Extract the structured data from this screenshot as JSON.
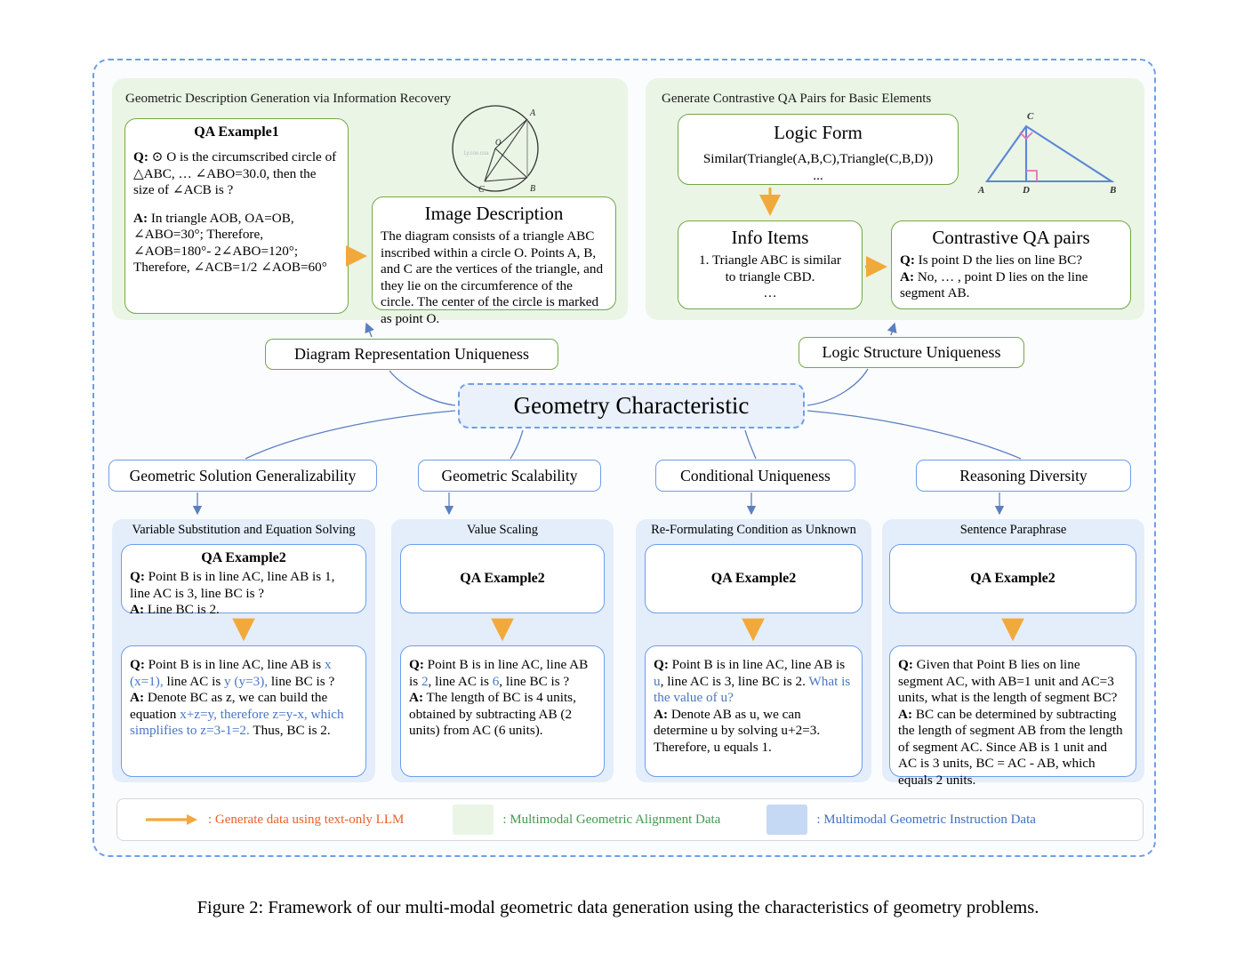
{
  "figure": {
    "caption": "Figure 2: Framework of our multi-modal geometric data generation using the characteristics of geometry problems."
  },
  "alignment_panels": [
    {
      "title": "Geometric Description Generation via Information Recovery",
      "qa_example": {
        "heading": "QA Example1",
        "question": "Q: ⊙ O is the circumscribed circle of △ABC, … ∠ABO=30.0, then the size of ∠ACB is ?",
        "question_prefix": "Q:",
        "question_body": " ⊙ O is the circumscribed circle of △ABC, … ∠ABO=30.0, then the size of ∠ACB is ?",
        "answer_prefix": "A:",
        "answer_body": " In triangle AOB, OA=OB, ∠ABO=30°; Therefore, ∠AOB=180°- 2∠ABO=120°; Therefore, ∠ACB=1/2 ∠AOB=60°"
      },
      "image_description": {
        "heading": "Image Description",
        "text": "The diagram consists of  a triangle ABC inscribed within a circle O. Points A, B, and C are the vertices of the triangle, and they lie on the circumference of the circle. The center of the circle is marked as point O."
      },
      "diagram_labels": [
        "A",
        "B",
        "C",
        "O"
      ]
    },
    {
      "title": "Generate Contrastive QA Pairs for Basic Elements",
      "logic_form": {
        "heading": "Logic Form",
        "text": "Similar(Triangle(A,B,C),Triangle(C,B,D))",
        "ellipsis": "..."
      },
      "info_items": {
        "heading": "Info Items",
        "line1": "1. Triangle ABC is similar",
        "line2": "to triangle CBD.",
        "ellipsis": "…"
      },
      "contrastive_qa": {
        "heading": "Contrastive  QA pairs",
        "question_prefix": "Q:",
        "question_body": " Is point D the lies on line BC?",
        "answer_prefix": "A:",
        "answer_body": " No, … , point D lies on the line segment AB."
      },
      "diagram_labels": [
        "A",
        "B",
        "C",
        "D"
      ]
    }
  ],
  "characteristic_nodes": {
    "center": "Geometry Characteristic",
    "upper": [
      {
        "label": "Diagram Representation Uniqueness"
      },
      {
        "label": "Logic Structure Uniqueness"
      }
    ],
    "lower": [
      {
        "label": "Geometric Solution Generalizability"
      },
      {
        "label": "Geometric Scalability"
      },
      {
        "label": "Conditional Uniqueness"
      },
      {
        "label": "Reasoning Diversity"
      }
    ]
  },
  "instruction_columns": [
    {
      "title": "Variable Substitution and Equation Solving",
      "source": {
        "heading": "QA Example2",
        "question_prefix": "Q:",
        "question_body": " Point B is in line AC, line AB is 1, line AC is 3, line BC is ?",
        "answer_prefix": "A:",
        "answer_body": " Line BC is 2."
      },
      "result": {
        "q_prefix": "Q:",
        "q_part1": " Point B is in line AC, line AB is ",
        "q_var1": "x (x=1),",
        "q_part2": " line AC is ",
        "q_var2": "y (y=3),",
        "q_part3": " line BC is ?",
        "a_prefix": "A:",
        "a_part1": " Denote BC as z, we can build the equation ",
        "a_highlight": "x+z=y, therefore z=y-x, which simplifies to z=3-1=2.",
        "a_part2": " Thus, BC is 2."
      }
    },
    {
      "title": "Value Scaling",
      "source": {
        "heading": "QA Example2"
      },
      "result": {
        "q_prefix": "Q:",
        "q_part1": " Point B is in line AC, line AB is ",
        "q_var1": "2",
        "q_part2": ", line AC is ",
        "q_var2": "6",
        "q_part3": ", line BC is ?",
        "a_prefix": "A:",
        "a_part1": " The length of BC is 4 units, obtained by subtracting AB (2 units) from AC (6 units)."
      }
    },
    {
      "title": "Re-Formulating Condition as Unknown",
      "source": {
        "heading": "QA Example2"
      },
      "result": {
        "q_prefix": "Q:",
        "q_part1": " Point B is in line AC, line AB is ",
        "q_var1": "u",
        "q_part2": ", line AC is 3, line BC is 2. ",
        "q_highlight": "What is the value of u?",
        "a_prefix": "A:",
        "a_part1": " Denote AB as u, we can determine u by solving u+2=3. Therefore, u equals 1."
      }
    },
    {
      "title": "Sentence Paraphrase",
      "source": {
        "heading": "QA Example2"
      },
      "result": {
        "q_prefix": "Q:",
        "q_part1": " Given that Point B lies on line segment AC, with AB=1 unit and AC=3 units, what is the length of segment BC?",
        "a_prefix": "A:",
        "a_part1": " BC can be determined by subtracting the length of segment AB from the length of segment AC. Since AB is 1 unit and AC is 3 units, BC = AC - AB, which equals 2 units."
      }
    }
  ],
  "legend": {
    "arrow_label": ": Generate data using text-only LLM",
    "alignment_label": ": Multimodal Geometric Alignment Data",
    "instruction_label": ": Multimodal Geometric Instruction Data",
    "arrow_color": "#f2a93b",
    "arrow_text_color": "#e8622a",
    "alignment_color": "#eaf5e6",
    "alignment_text_color": "#3f9a4e",
    "instruction_color": "#c6d9f4",
    "instruction_text_color": "#3d6fc6"
  },
  "colors": {
    "outer_dash": "#6d9eeb",
    "green_panel_bg": "#eaf5e6",
    "green_border": "#72a844",
    "blue_panel_bg": "#e4edfa",
    "blue_border": "#6d9eeb",
    "center_bg": "#eaf1fb",
    "connector": "#5b7fc0",
    "gen_arrow": "#f2a93b"
  }
}
